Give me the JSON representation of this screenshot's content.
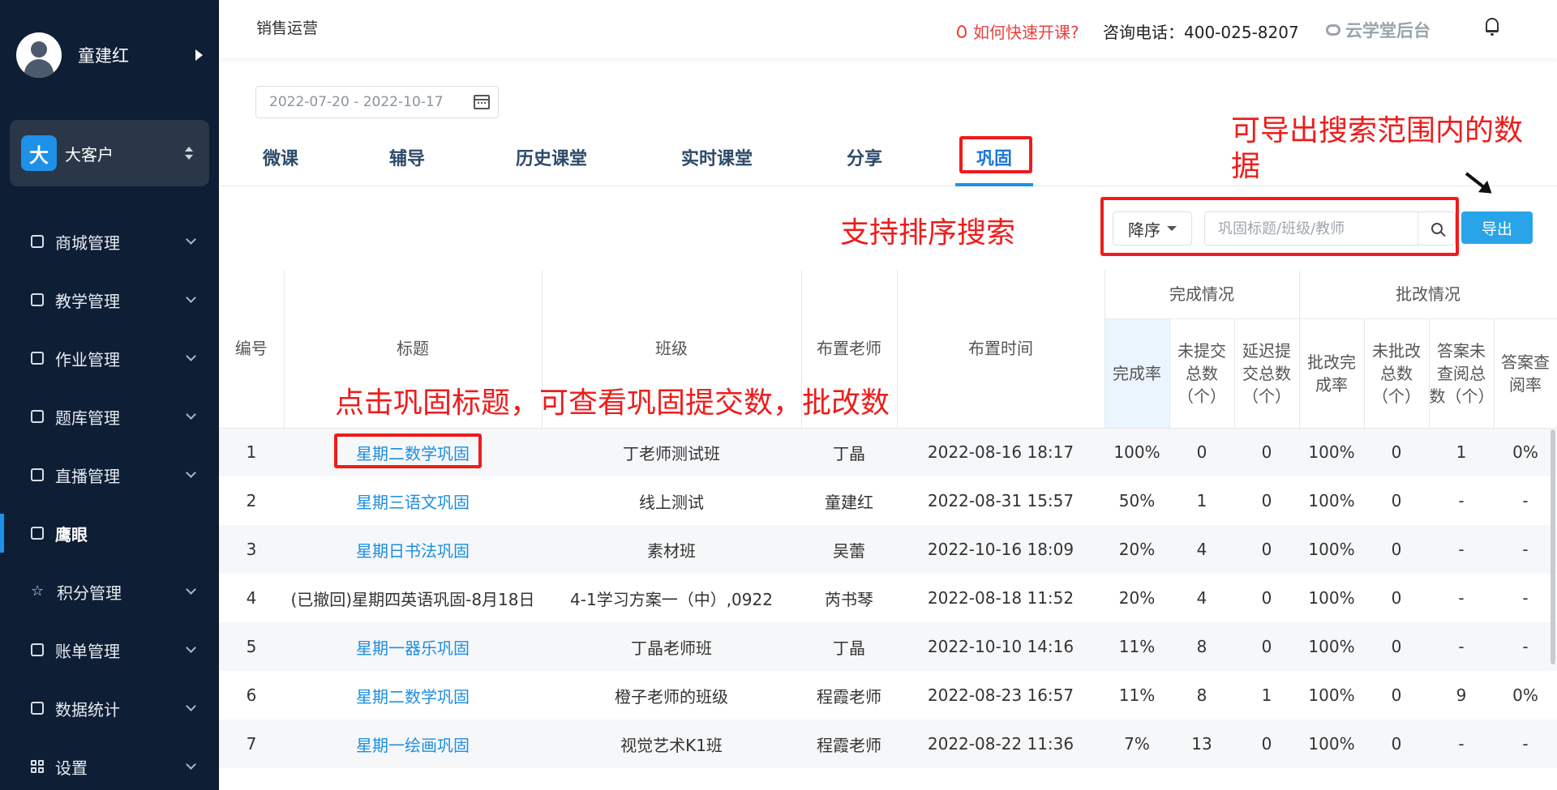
{
  "sidebar": {
    "user_name": "童建红",
    "org_badge": "大",
    "org_name": "大客户",
    "items": [
      {
        "label": "商城管理",
        "icon": "store-icon",
        "expandable": true
      },
      {
        "label": "教学管理",
        "icon": "book-icon",
        "expandable": true
      },
      {
        "label": "作业管理",
        "icon": "document-icon",
        "expandable": true
      },
      {
        "label": "题库管理",
        "icon": "question-bank-icon",
        "expandable": true
      },
      {
        "label": "直播管理",
        "icon": "live-icon",
        "expandable": true
      },
      {
        "label": "鹰眼",
        "icon": "eye-icon",
        "expandable": false,
        "active": true
      },
      {
        "label": "积分管理",
        "icon": "star-icon",
        "expandable": true
      },
      {
        "label": "账单管理",
        "icon": "bill-icon",
        "expandable": true
      },
      {
        "label": "数据统计",
        "icon": "chart-icon",
        "expandable": true
      },
      {
        "label": "设置",
        "icon": "grid-icon",
        "expandable": true
      }
    ]
  },
  "header": {
    "breadcrumb": "销售运营",
    "help_link": "如何快速开课?",
    "phone": "咨询电话：400-025-8207",
    "brand": "云学堂后台"
  },
  "filters": {
    "date_range": "2022-07-20 - 2022-10-17"
  },
  "tabs": [
    {
      "label": "微课"
    },
    {
      "label": "辅导"
    },
    {
      "label": "历史课堂"
    },
    {
      "label": "实时课堂"
    },
    {
      "label": "分享"
    },
    {
      "label": "巩固",
      "active": true
    }
  ],
  "toolbar": {
    "sort_label": "降序",
    "search_placeholder": "巩固标题/班级/教师",
    "export_label": "导出"
  },
  "annotations": {
    "export_note": "可导出搜索范围内的数据",
    "sort_note": "支持排序搜索",
    "title_note": "点击巩固标题，可查看巩固提交数，批改数"
  },
  "table": {
    "headers": {
      "id": "编号",
      "title": "标题",
      "class": "班级",
      "teacher": "布置老师",
      "time": "布置时间",
      "completion_group": "完成情况",
      "grading_group": "批改情况",
      "completion_rate": "完成率",
      "unsubmitted": "未提交总数（个）",
      "late": "延迟提交总数（个）",
      "graded_rate": "批改完成率",
      "ungraded": "未批改总数（个）",
      "unread": "答案未查阅总数（个）",
      "read_rate": "答案查阅率"
    },
    "rows": [
      {
        "id": "1",
        "title": "星期二数学巩固",
        "class": "丁老师测试班",
        "teacher": "丁晶",
        "time": "2022-08-16 18:17",
        "completion_rate": "100%",
        "unsubmitted": "0",
        "late": "0",
        "graded_rate": "100%",
        "ungraded": "0",
        "unread": "1",
        "read_rate": "0%"
      },
      {
        "id": "2",
        "title": "星期三语文巩固",
        "class": "线上测试",
        "teacher": "童建红",
        "time": "2022-08-31 15:57",
        "completion_rate": "50%",
        "unsubmitted": "1",
        "late": "0",
        "graded_rate": "100%",
        "ungraded": "0",
        "unread": "-",
        "read_rate": "-"
      },
      {
        "id": "3",
        "title": "星期日书法巩固",
        "class": "素材班",
        "teacher": "吴蕾",
        "time": "2022-10-16 18:09",
        "completion_rate": "20%",
        "unsubmitted": "4",
        "late": "0",
        "graded_rate": "100%",
        "ungraded": "0",
        "unread": "-",
        "read_rate": "-"
      },
      {
        "id": "4",
        "title": "(已撤回)星期四英语巩固-8月18日",
        "class": "4-1学习方案一（中）,0922",
        "teacher": "芮书琴",
        "time": "2022-08-18 11:52",
        "completion_rate": "20%",
        "unsubmitted": "4",
        "late": "0",
        "graded_rate": "100%",
        "ungraded": "0",
        "unread": "-",
        "read_rate": "-",
        "revoked": true
      },
      {
        "id": "5",
        "title": "星期一器乐巩固",
        "class": "丁晶老师班",
        "teacher": "丁晶",
        "time": "2022-10-10 14:16",
        "completion_rate": "11%",
        "unsubmitted": "8",
        "late": "0",
        "graded_rate": "100%",
        "ungraded": "0",
        "unread": "-",
        "read_rate": "-"
      },
      {
        "id": "6",
        "title": "星期二数学巩固",
        "class": "橙子老师的班级",
        "teacher": "程霞老师",
        "time": "2022-08-23 16:57",
        "completion_rate": "11%",
        "unsubmitted": "8",
        "late": "1",
        "graded_rate": "100%",
        "ungraded": "0",
        "unread": "9",
        "read_rate": "0%"
      },
      {
        "id": "7",
        "title": "星期一绘画巩固",
        "class": "视觉艺术K1班",
        "teacher": "程霞老师",
        "time": "2022-08-22 11:36",
        "completion_rate": "7%",
        "unsubmitted": "13",
        "late": "0",
        "graded_rate": "100%",
        "ungraded": "0",
        "unread": "-",
        "read_rate": "-"
      }
    ]
  },
  "colors": {
    "sidebar_bg": "#0e1e35",
    "accent": "#1e90e8",
    "annotation_red": "#ee1c1c",
    "link_blue": "#1e8ee0"
  }
}
